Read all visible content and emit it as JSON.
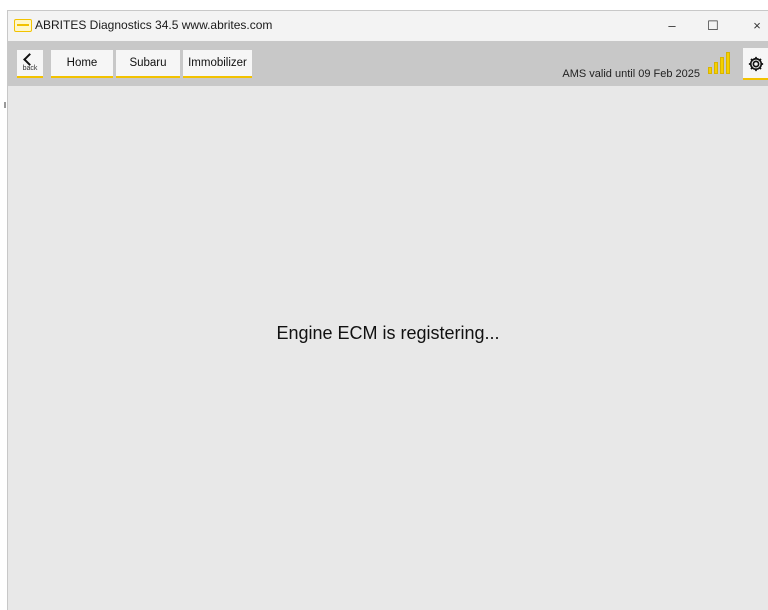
{
  "window": {
    "title": "ABRITES Diagnostics 34.5   www.abrites.com",
    "controls": {
      "minimize": "–",
      "maximize": "☐",
      "close": "×"
    }
  },
  "toolbar": {
    "back_label": "back",
    "tabs": [
      {
        "label": "Home"
      },
      {
        "label": "Subaru"
      },
      {
        "label": "Immobilizer"
      }
    ],
    "ams_status": "AMS valid until 09 Feb 2025",
    "signal_bars": 4,
    "icons": {
      "back": "chevron-left-icon",
      "signal": "signal-strength-icon",
      "settings": "gear-icon",
      "app": "abrites-logo-icon"
    }
  },
  "main": {
    "status_message": "Engine ECM is registering..."
  },
  "colors": {
    "accent": "#f2c200",
    "toolbar_bg": "#c8c8c8",
    "content_bg": "#e8e8e8"
  }
}
